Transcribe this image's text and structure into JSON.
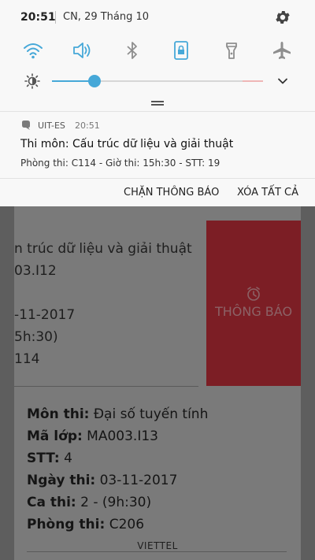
{
  "status": {
    "time": "20:51",
    "date": "CN, 29 Tháng 10"
  },
  "colors": {
    "accent": "#46a8d8",
    "swipe_action": "#7c1e25"
  },
  "quick_settings": {
    "icons": [
      "wifi-icon",
      "sound-icon",
      "bluetooth-icon",
      "screen-lock-rotation-icon",
      "flashlight-icon",
      "airplane-mode-icon"
    ]
  },
  "brightness": {
    "level_percent": 20
  },
  "notification": {
    "app_name": "UIT-ES",
    "time": "20:51",
    "title": "Thi môn: Cấu trúc dữ liệu và giải thuật",
    "body": "Phòng thi: C114 - Giờ thi: 15h:30 - STT: 19"
  },
  "actions": {
    "block": "CHẶN THÔNG BÁO",
    "clear_all": "XÓA TẤT CẢ"
  },
  "background_app": {
    "card1_lines": [
      "n trúc dữ liệu và giải thuật",
      "03.I12",
      "",
      "-11-2017",
      "5h:30)",
      "114"
    ],
    "swipe_label": "THÔNG BÁO",
    "card2": [
      {
        "label": "Môn thi:",
        "value": " Đại số tuyến tính"
      },
      {
        "label": "Mã lớp:",
        "value": " MA003.I13"
      },
      {
        "label": "STT:",
        "value": " 4"
      },
      {
        "label": "Ngày thi:",
        "value": " 03-11-2017"
      },
      {
        "label": "Ca thi:",
        "value": " 2 - (9h:30)"
      },
      {
        "label": "Phòng thi:",
        "value": " C206"
      }
    ]
  },
  "carrier": "VIETTEL"
}
